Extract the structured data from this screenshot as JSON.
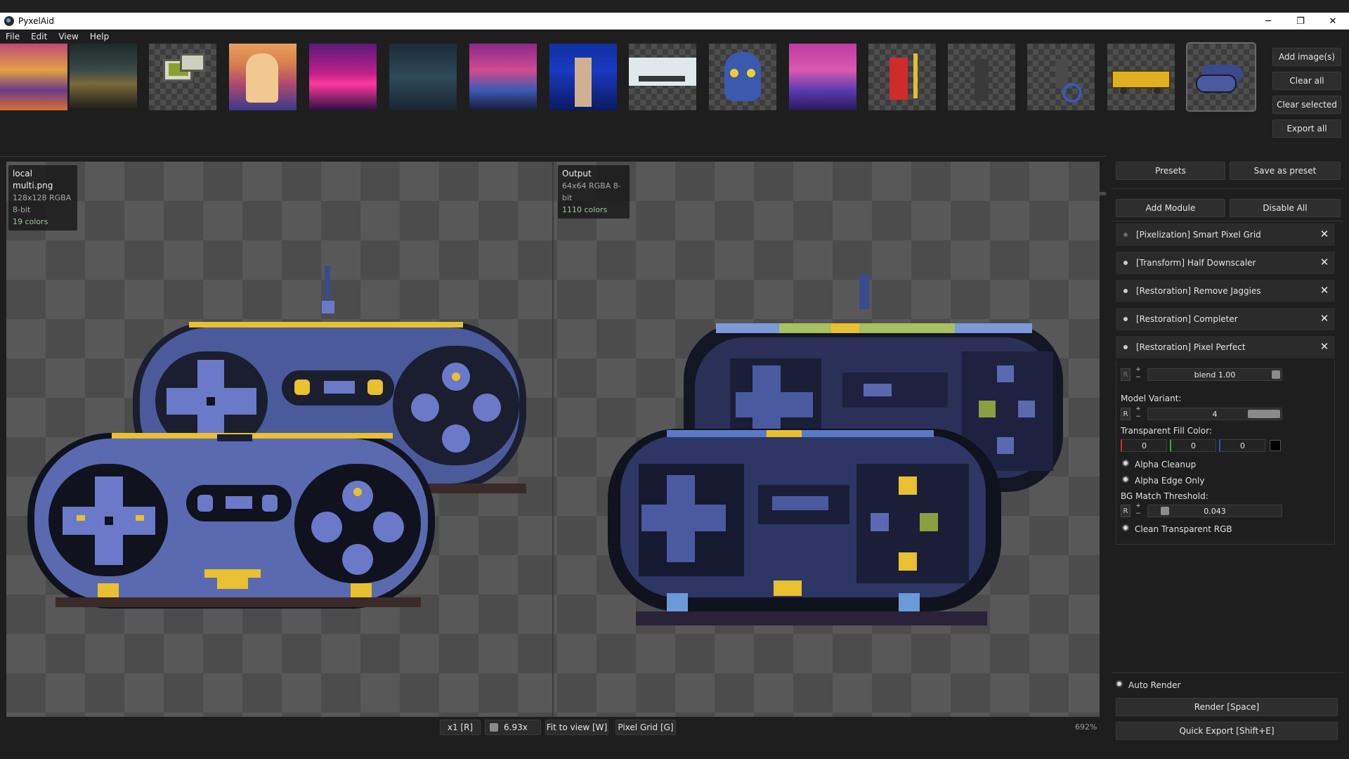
{
  "window": {
    "title": "PyxelAid",
    "minimize": "─",
    "restore": "❐",
    "close": "✕"
  },
  "menu": [
    "File",
    "Edit",
    "View",
    "Help"
  ],
  "thumbnails": [
    "crowd-of-characters",
    "dark-throne-room",
    "retro-computers",
    "blonde-woman-portrait",
    "neon-city-car",
    "torii-gate-night",
    "woman-neon-outfit",
    "poster-dancer",
    "platformer-level",
    "neon-skull",
    "pink-hair-woman",
    "red-robed-wizard",
    "armored-warrior",
    "wheelchair-figure",
    "school-bus",
    "game-controllers"
  ],
  "actions": {
    "add_images": "Add image(s)",
    "clear_all": "Clear all",
    "clear_selected": "Clear selected",
    "export_all": "Export all"
  },
  "input_info": {
    "name": "local multi.png",
    "meta": "128x128  RGBA  8-bit",
    "colors": "19 colors"
  },
  "output_info": {
    "name": "Output",
    "meta": "64x64  RGBA  8-bit",
    "colors": "1110 colors"
  },
  "view_toolbar": {
    "scale": "x1 [R]",
    "zoom": "6.93x",
    "fit": "Fit to view [W]",
    "pixel_grid": "Pixel Grid [G]",
    "zoom_percent": "692%"
  },
  "panel": {
    "presets": "Presets",
    "save_preset": "Save as preset",
    "add_module": "Add Module",
    "disable_all": "Disable All",
    "modules": [
      "[Pixelization] Smart Pixel Grid",
      "[Transform] Half Downscaler",
      "[Restoration] Remove Jaggies",
      "[Restoration] Completer",
      "[Restoration] Pixel Perfect"
    ],
    "blend": "blend 1.00",
    "model_variant_label": "Model Variant:",
    "model_variant": "4",
    "fill_color_label": "Transparent Fill Color:",
    "fill_r": "0",
    "fill_g": "0",
    "fill_b": "0",
    "alpha_cleanup": "Alpha Cleanup",
    "alpha_edge_only": "Alpha Edge Only",
    "bg_threshold_label": "BG Match Threshold:",
    "bg_threshold": "0.043",
    "clean_rgb": "Clean Transparent RGB",
    "auto_render": "Auto Render",
    "render": "Render  [Space]",
    "quick_export": "Quick Export  [Shift+E]",
    "reset": "R",
    "plus": "+",
    "minus": "−"
  }
}
